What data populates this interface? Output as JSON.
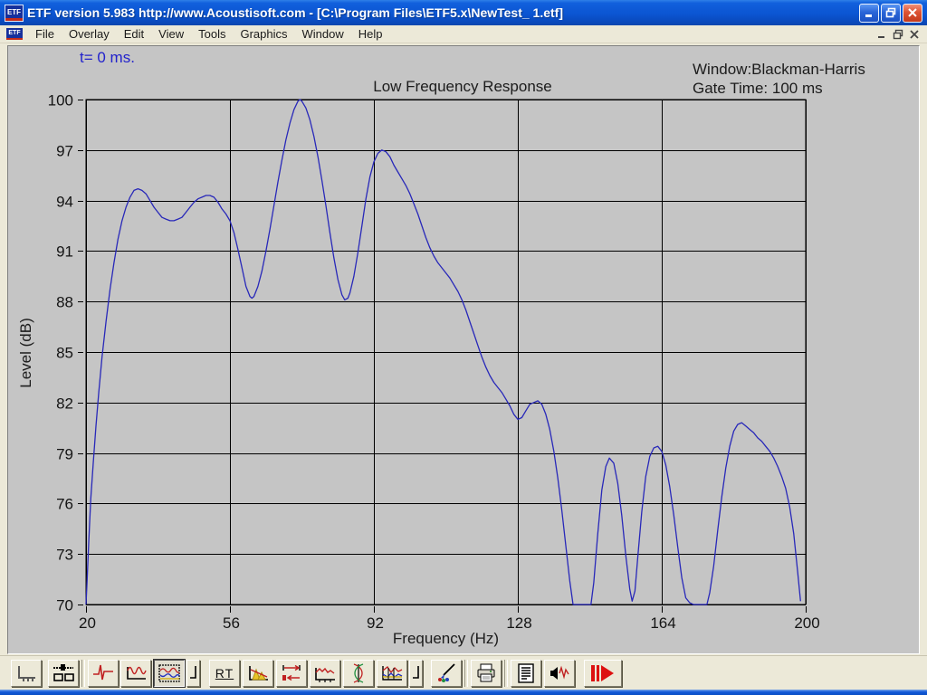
{
  "window": {
    "title": "ETF version 5.983 http://www.Acoustisoft.com - [C:\\Program Files\\ETF5.x\\NewTest_ 1.etf]",
    "icon_text": "ETF",
    "controls": [
      "minimize",
      "restore",
      "close"
    ],
    "mdi_controls": [
      "minimize",
      "restore",
      "close"
    ]
  },
  "menu": {
    "items": [
      "File",
      "Overlay",
      "Edit",
      "View",
      "Tools",
      "Graphics",
      "Window",
      "Help"
    ]
  },
  "annotations": {
    "time_label": "t= 0 ms.",
    "window_label": "Window:Blackman-Harris",
    "gate_label": "Gate Time: 100 ms"
  },
  "toolbar": {
    "rt_label": "RT",
    "buttons": [
      {
        "name": "graph-setup",
        "icon": "axes-icon"
      },
      {
        "name": "display-layout",
        "icon": "slider-panes-icon"
      },
      {
        "name": "impulse-response",
        "icon": "impulse-icon"
      },
      {
        "name": "periodic-response",
        "icon": "sine-ripple-icon"
      },
      {
        "name": "frequency-response",
        "icon": "spectrum-chart-icon",
        "pressed": true
      },
      {
        "name": "marker-left",
        "icon": "corner-mark-icon"
      },
      {
        "name": "reverb-time",
        "icon": "rt-text"
      },
      {
        "name": "waterfall",
        "icon": "waterfall-icon"
      },
      {
        "name": "gating",
        "icon": "gate-arrows-icon"
      },
      {
        "name": "step-response",
        "icon": "jagged-line-icon"
      },
      {
        "name": "phase-response",
        "icon": "phase-waves-icon"
      },
      {
        "name": "overlay-response",
        "icon": "overlay-chart-icon"
      },
      {
        "name": "marker-right",
        "icon": "corner-mark-icon"
      },
      {
        "name": "color-settings",
        "icon": "paintbrush-icon"
      },
      {
        "name": "print",
        "icon": "printer-icon"
      },
      {
        "name": "measurement-notes",
        "icon": "document-icon"
      },
      {
        "name": "play-signal",
        "icon": "speaker-wave-icon"
      },
      {
        "name": "start-measurement",
        "icon": "play-arrow-icon"
      }
    ]
  },
  "colors": {
    "curve": "#2828b9",
    "chart_background": "#c5c5c5",
    "grid": "#000000",
    "chrome": "#ece9d8",
    "titlebar_blue": "#0b55d2",
    "annotation_blue": "#2222cc"
  },
  "chart_data": {
    "type": "line",
    "title": "Low Frequency Response",
    "xlabel": "Frequency (Hz)",
    "ylabel": "Level (dB)",
    "xlim": [
      20,
      200
    ],
    "ylim": [
      70,
      100
    ],
    "xticks": [
      20,
      56,
      92,
      128,
      164,
      200
    ],
    "yticks": [
      100,
      97,
      94,
      91,
      88,
      85,
      82,
      79,
      76,
      73,
      70
    ],
    "grid": true,
    "legend": null,
    "line_color": "#2828b9",
    "series": [
      {
        "name": "low-frequency-response",
        "points": [
          [
            20,
            70
          ],
          [
            20.3,
            71.5
          ],
          [
            20.7,
            73.8
          ],
          [
            21.2,
            76.3
          ],
          [
            21.8,
            78.4
          ],
          [
            22.5,
            80.6
          ],
          [
            23.2,
            82.6
          ],
          [
            24,
            84.7
          ],
          [
            25,
            86.8
          ],
          [
            26,
            88.7
          ],
          [
            27,
            90.3
          ],
          [
            28,
            91.7
          ],
          [
            29,
            92.8
          ],
          [
            30,
            93.6
          ],
          [
            31,
            94.2
          ],
          [
            32,
            94.6
          ],
          [
            33,
            94.7
          ],
          [
            34,
            94.6
          ],
          [
            35,
            94.4
          ],
          [
            36,
            94.0
          ],
          [
            37,
            93.6
          ],
          [
            38,
            93.3
          ],
          [
            39,
            93.0
          ],
          [
            40,
            92.9
          ],
          [
            41,
            92.8
          ],
          [
            42,
            92.8
          ],
          [
            43,
            92.9
          ],
          [
            44,
            93.0
          ],
          [
            45,
            93.3
          ],
          [
            46,
            93.6
          ],
          [
            47,
            93.9
          ],
          [
            48,
            94.1
          ],
          [
            49,
            94.2
          ],
          [
            50,
            94.3
          ],
          [
            51,
            94.3
          ],
          [
            52,
            94.2
          ],
          [
            53,
            93.9
          ],
          [
            54,
            93.5
          ],
          [
            55,
            93.2
          ],
          [
            56,
            92.8
          ],
          [
            57,
            92.1
          ],
          [
            58,
            91.1
          ],
          [
            59,
            90.0
          ],
          [
            60,
            88.9
          ],
          [
            61,
            88.3
          ],
          [
            61.5,
            88.2
          ],
          [
            62,
            88.3
          ],
          [
            63,
            88.9
          ],
          [
            64,
            89.8
          ],
          [
            65,
            91.0
          ],
          [
            66,
            92.3
          ],
          [
            67,
            93.7
          ],
          [
            68,
            95.1
          ],
          [
            69,
            96.4
          ],
          [
            70,
            97.6
          ],
          [
            71,
            98.6
          ],
          [
            72,
            99.4
          ],
          [
            73,
            99.9
          ],
          [
            73.5,
            100
          ],
          [
            74,
            99.9
          ],
          [
            75,
            99.5
          ],
          [
            76,
            98.8
          ],
          [
            77,
            97.8
          ],
          [
            78,
            96.6
          ],
          [
            79,
            95.2
          ],
          [
            80,
            93.7
          ],
          [
            81,
            92.1
          ],
          [
            82,
            90.6
          ],
          [
            83,
            89.3
          ],
          [
            84,
            88.4
          ],
          [
            84.7,
            88.1
          ],
          [
            85.5,
            88.2
          ],
          [
            86,
            88.5
          ],
          [
            87,
            89.5
          ],
          [
            88,
            90.9
          ],
          [
            89,
            92.5
          ],
          [
            90,
            94.1
          ],
          [
            91,
            95.4
          ],
          [
            92,
            96.3
          ],
          [
            93,
            96.8
          ],
          [
            94,
            97.0
          ],
          [
            95,
            96.9
          ],
          [
            96,
            96.6
          ],
          [
            97,
            96.1
          ],
          [
            98,
            95.7
          ],
          [
            99,
            95.3
          ],
          [
            100,
            94.9
          ],
          [
            101,
            94.4
          ],
          [
            102,
            93.8
          ],
          [
            103,
            93.2
          ],
          [
            104,
            92.5
          ],
          [
            105,
            91.8
          ],
          [
            106,
            91.2
          ],
          [
            107,
            90.7
          ],
          [
            108,
            90.3
          ],
          [
            109,
            90.0
          ],
          [
            110,
            89.7
          ],
          [
            111,
            89.4
          ],
          [
            112,
            89.0
          ],
          [
            113,
            88.6
          ],
          [
            114,
            88.1
          ],
          [
            115,
            87.5
          ],
          [
            116,
            86.8
          ],
          [
            117,
            86.1
          ],
          [
            118,
            85.4
          ],
          [
            119,
            84.7
          ],
          [
            120,
            84.1
          ],
          [
            121,
            83.6
          ],
          [
            122,
            83.2
          ],
          [
            123,
            82.9
          ],
          [
            124,
            82.6
          ],
          [
            125,
            82.2
          ],
          [
            126,
            81.8
          ],
          [
            127,
            81.3
          ],
          [
            128,
            81.0
          ],
          [
            129,
            81.1
          ],
          [
            130,
            81.5
          ],
          [
            131,
            81.9
          ],
          [
            132,
            82.0
          ],
          [
            133,
            82.1
          ],
          [
            134,
            81.9
          ],
          [
            135,
            81.3
          ],
          [
            136,
            80.4
          ],
          [
            137,
            79.1
          ],
          [
            138,
            77.5
          ],
          [
            139,
            75.6
          ],
          [
            140,
            73.5
          ],
          [
            141,
            71.4
          ],
          [
            141.8,
            70
          ],
          [
            146.3,
            70
          ],
          [
            147,
            71.3
          ],
          [
            148,
            74.2
          ],
          [
            149,
            76.8
          ],
          [
            150,
            78.2
          ],
          [
            150.9,
            78.7
          ],
          [
            152,
            78.4
          ],
          [
            153,
            77.2
          ],
          [
            154,
            75.3
          ],
          [
            155,
            72.9
          ],
          [
            156,
            70.9
          ],
          [
            156.6,
            70.2
          ],
          [
            157.3,
            70.8
          ],
          [
            158,
            72.8
          ],
          [
            159,
            75.5
          ],
          [
            160,
            77.6
          ],
          [
            161,
            78.8
          ],
          [
            162,
            79.3
          ],
          [
            163,
            79.4
          ],
          [
            164,
            79.1
          ],
          [
            165,
            78.3
          ],
          [
            166,
            77.0
          ],
          [
            167,
            75.3
          ],
          [
            168,
            73.4
          ],
          [
            169,
            71.6
          ],
          [
            170,
            70.4
          ],
          [
            171,
            70.1
          ],
          [
            171.9,
            70
          ],
          [
            175.3,
            70
          ],
          [
            176,
            70.7
          ],
          [
            177,
            72.3
          ],
          [
            178,
            74.4
          ],
          [
            179,
            76.4
          ],
          [
            180,
            78.1
          ],
          [
            181,
            79.4
          ],
          [
            182,
            80.3
          ],
          [
            183,
            80.7
          ],
          [
            184,
            80.8
          ],
          [
            185,
            80.6
          ],
          [
            186,
            80.4
          ],
          [
            187,
            80.2
          ],
          [
            188,
            79.9
          ],
          [
            189,
            79.7
          ],
          [
            190,
            79.4
          ],
          [
            191,
            79.1
          ],
          [
            192,
            78.7
          ],
          [
            193,
            78.2
          ],
          [
            194,
            77.6
          ],
          [
            195,
            76.9
          ],
          [
            196,
            75.8
          ],
          [
            197,
            74.2
          ],
          [
            198,
            71.9
          ],
          [
            198.7,
            70.2
          ]
        ]
      }
    ]
  }
}
